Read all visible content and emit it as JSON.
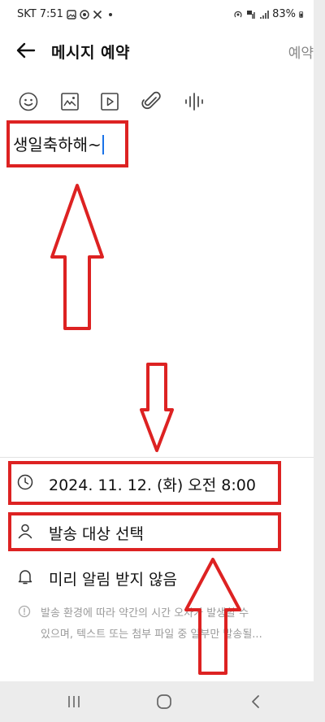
{
  "status": {
    "carrier": "SKT",
    "time": "7:51",
    "battery": "83%"
  },
  "header": {
    "title": "메시지 예약",
    "action_label": "예약"
  },
  "toolbar": {
    "icons": [
      "emoji-icon",
      "image-icon",
      "video-icon",
      "attach-icon",
      "voice-icon"
    ]
  },
  "message": {
    "text": "생일축하해~"
  },
  "schedule": {
    "datetime": "2024. 11. 12. (화) 오전 8:00"
  },
  "recipients": {
    "label": "발송 대상 선택"
  },
  "reminder": {
    "label": "미리 알림 받지 않음"
  },
  "notice": {
    "text": "발송 환경에 따라 약간의 시간 오차가 발생할 수\n있으며, 텍스트 또는 첨부 파일 중 일부만 발송될..."
  },
  "colors": {
    "highlight": "#dd2222",
    "caret": "#1a73e8"
  }
}
